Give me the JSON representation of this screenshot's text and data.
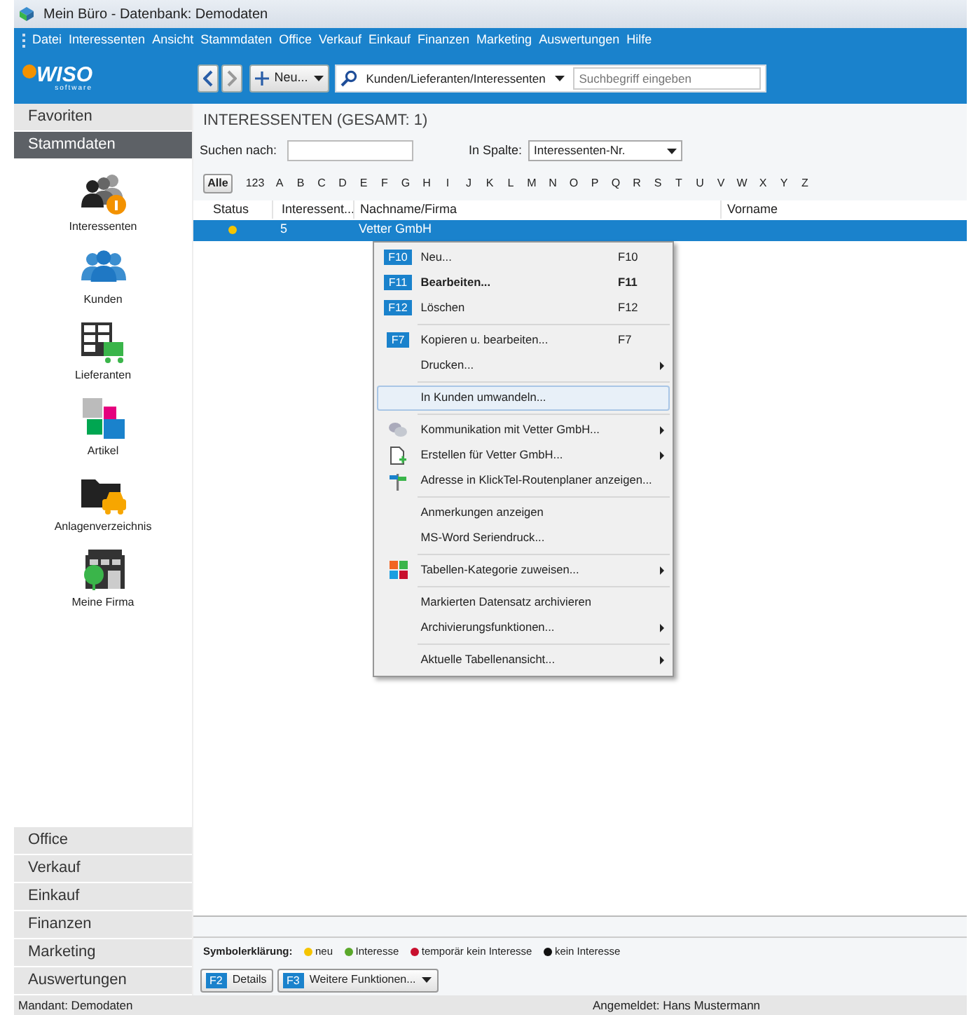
{
  "window": {
    "title": "Mein Büro - Datenbank: Demodaten"
  },
  "menu_bar": [
    "Datei",
    "Interessenten",
    "Ansicht",
    "Stammdaten",
    "Office",
    "Verkauf",
    "Einkauf",
    "Finanzen",
    "Marketing",
    "Auswertungen",
    "Hilfe"
  ],
  "logo": {
    "text": "WISO",
    "subtitle": "software"
  },
  "toolbar": {
    "new_button": "Neu...",
    "search_scope": "Kunden/Lieferanten/Interessenten",
    "search": {
      "placeholder": "Suchbegriff eingeben"
    }
  },
  "sidebar": {
    "top_items": [
      {
        "label": "Favoriten",
        "selected": false
      },
      {
        "label": "Stammdaten",
        "selected": true
      }
    ],
    "modules": [
      {
        "label": "Interessenten"
      },
      {
        "label": "Kunden"
      },
      {
        "label": "Lieferanten"
      },
      {
        "label": "Artikel"
      },
      {
        "label": "Anlagenverzeichnis"
      },
      {
        "label": "Meine Firma"
      }
    ],
    "bottom_items": [
      {
        "label": "Office",
        "selected": false
      },
      {
        "label": "Verkauf",
        "selected": false
      },
      {
        "label": "Einkauf",
        "selected": false
      },
      {
        "label": "Finanzen",
        "selected": false
      },
      {
        "label": "Marketing",
        "selected": false
      },
      {
        "label": "Auswertungen",
        "selected": false
      }
    ]
  },
  "content": {
    "title": "INTERESSENTEN (GESAMT: 1)",
    "search_label": "Suchen nach:",
    "column_label": "In Spalte:",
    "column_value": "Interessenten-Nr.",
    "letters": [
      {
        "label": "Alle",
        "selected": true
      },
      {
        "label": "123",
        "selected": false
      },
      {
        "label": "A",
        "selected": false
      },
      {
        "label": "B",
        "selected": false
      },
      {
        "label": "C",
        "selected": false
      },
      {
        "label": "D",
        "selected": false
      },
      {
        "label": "E",
        "selected": false
      },
      {
        "label": "F",
        "selected": false
      },
      {
        "label": "G",
        "selected": false
      },
      {
        "label": "H",
        "selected": false
      },
      {
        "label": "I",
        "selected": false
      },
      {
        "label": "J",
        "selected": false
      },
      {
        "label": "K",
        "selected": false
      },
      {
        "label": "L",
        "selected": false
      },
      {
        "label": "M",
        "selected": false
      },
      {
        "label": "N",
        "selected": false
      },
      {
        "label": "O",
        "selected": false
      },
      {
        "label": "P",
        "selected": false
      },
      {
        "label": "Q",
        "selected": false
      },
      {
        "label": "R",
        "selected": false
      },
      {
        "label": "S",
        "selected": false
      },
      {
        "label": "T",
        "selected": false
      },
      {
        "label": "U",
        "selected": false
      },
      {
        "label": "V",
        "selected": false
      },
      {
        "label": "W",
        "selected": false
      },
      {
        "label": "X",
        "selected": false
      },
      {
        "label": "Y",
        "selected": false
      },
      {
        "label": "Z",
        "selected": false
      }
    ],
    "table": {
      "columns": [
        "Status",
        "Interessent...",
        "Nachname/Firma",
        "Vorname"
      ],
      "rows": [
        {
          "color": "#f5c400",
          "number": "5",
          "name": "Vetter GmbH",
          "selected": true
        }
      ]
    }
  },
  "context_menu": [
    [
      {
        "label": "Neu...",
        "key": "F10",
        "shortcut": "F10",
        "selected": false
      },
      {
        "label": "Bearbeiten...",
        "key": "F11",
        "shortcut": "F11",
        "bold": true,
        "selected": false
      },
      {
        "label": "Löschen",
        "key": "F12",
        "shortcut": "F12",
        "selected": false
      }
    ],
    [
      {
        "label": "Kopieren u. bearbeiten...",
        "key": "F7",
        "shortcut": "F7",
        "selected": false
      },
      {
        "label": "Drucken...",
        "submenu": true,
        "selected": false
      }
    ],
    [
      {
        "label": "In Kunden umwandeln...",
        "selected": true
      }
    ],
    [
      {
        "label": "Kommunikation mit Vetter GmbH...",
        "submenu": true,
        "selected": false
      },
      {
        "label": "Erstellen für Vetter GmbH...",
        "submenu": true,
        "selected": false
      },
      {
        "label": "Adresse in KlickTel-Routenplaner anzeigen...",
        "selected": false
      }
    ],
    [
      {
        "label": "Anmerkungen anzeigen",
        "selected": false
      },
      {
        "label": "MS-Word Seriendruck...",
        "selected": false
      }
    ],
    [
      {
        "label": "Tabellen-Kategorie zuweisen...",
        "submenu": true,
        "selected": false
      }
    ],
    [
      {
        "label": "Markierten Datensatz archivieren",
        "selected": false
      },
      {
        "label": "Archivierungsfunktionen...",
        "submenu": true,
        "selected": false
      }
    ],
    [
      {
        "label": "Aktuelle Tabellenansicht...",
        "submenu": true,
        "selected": false
      }
    ]
  ],
  "legend": {
    "label": "Symbolerklärung:",
    "items": [
      {
        "label": "neu",
        "color": "#f5c400"
      },
      {
        "label": "Interesse",
        "color": "#5aa82a"
      },
      {
        "label": "temporär kein Interesse",
        "color": "#c8102e"
      },
      {
        "label": "kein Interesse",
        "color": "#111111"
      }
    ]
  },
  "footer_buttons": [
    {
      "key": "F2",
      "label": "Details",
      "dropdown": false
    },
    {
      "key": "F3",
      "label": "Weitere Funktionen...",
      "dropdown": true
    }
  ],
  "status_bar": {
    "left": "Mandant: Demodaten",
    "right": "Angemeldet: Hans Mustermann"
  }
}
